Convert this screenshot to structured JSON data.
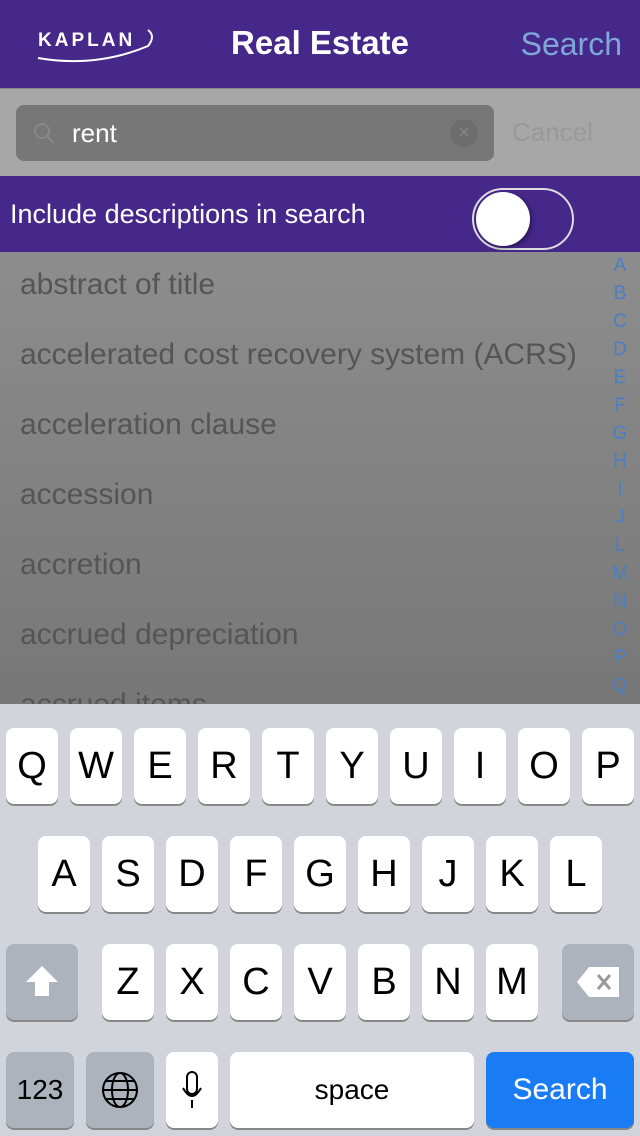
{
  "nav": {
    "logo": "KAPLAN",
    "title": "Real Estate",
    "search_button": "Search"
  },
  "search": {
    "value": "rent",
    "cancel": "Cancel"
  },
  "toggle": {
    "label": "Include descriptions in search",
    "on": false
  },
  "list": [
    "abstract of title",
    "accelerated cost recovery system (ACRS)",
    "acceleration clause",
    "accession",
    "accretion",
    "accrued depreciation",
    "accrued items"
  ],
  "index": [
    "A",
    "B",
    "C",
    "D",
    "E",
    "F",
    "G",
    "H",
    "I",
    "J",
    "L",
    "M",
    "N",
    "O",
    "P",
    "Q"
  ],
  "keyboard": {
    "row1": [
      "Q",
      "W",
      "E",
      "R",
      "T",
      "Y",
      "U",
      "I",
      "O",
      "P"
    ],
    "row2": [
      "A",
      "S",
      "D",
      "F",
      "G",
      "H",
      "J",
      "K",
      "L"
    ],
    "row3": [
      "Z",
      "X",
      "C",
      "V",
      "B",
      "N",
      "M"
    ],
    "numbers": "123",
    "space": "space",
    "return": "Search"
  },
  "colors": {
    "brand": "#46278a",
    "accent": "#1a7cf5"
  }
}
